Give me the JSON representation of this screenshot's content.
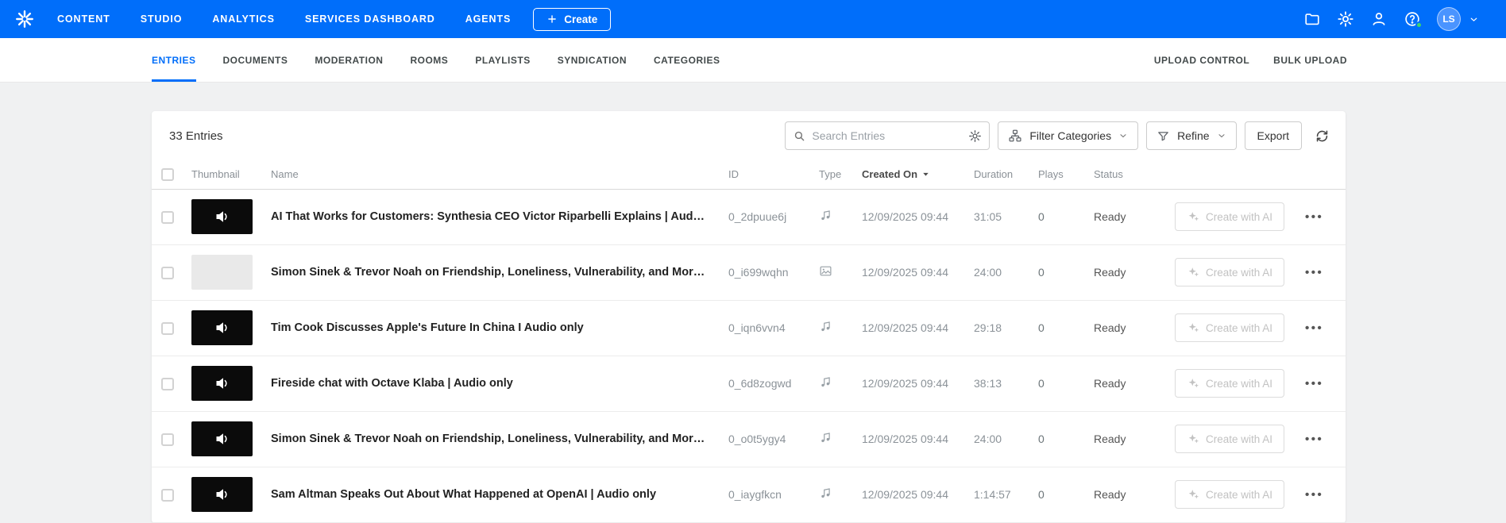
{
  "colors": {
    "accent": "#006EFA",
    "topbar": "#006EFA",
    "online_dot": "#3ED46B"
  },
  "topbar": {
    "nav": [
      {
        "label": "CONTENT",
        "active": true
      },
      {
        "label": "STUDIO",
        "active": false
      },
      {
        "label": "ANALYTICS",
        "active": false
      },
      {
        "label": "SERVICES DASHBOARD",
        "active": false
      },
      {
        "label": "AGENTS",
        "active": false
      }
    ],
    "create_label": "Create",
    "avatar_initials": "LS"
  },
  "tabs": {
    "items": [
      {
        "label": "ENTRIES",
        "active": true
      },
      {
        "label": "DOCUMENTS",
        "active": false
      },
      {
        "label": "MODERATION",
        "active": false
      },
      {
        "label": "ROOMS",
        "active": false
      },
      {
        "label": "PLAYLISTS",
        "active": false
      },
      {
        "label": "SYNDICATION",
        "active": false
      },
      {
        "label": "CATEGORIES",
        "active": false
      }
    ],
    "right_items": [
      {
        "label": "UPLOAD CONTROL"
      },
      {
        "label": "BULK UPLOAD"
      }
    ]
  },
  "toolbar": {
    "count": "33 Entries",
    "search_placeholder": "Search Entries",
    "filter_label": "Filter Categories",
    "refine_label": "Refine",
    "export_label": "Export"
  },
  "table": {
    "headers": {
      "thumbnail": "Thumbnail",
      "name": "Name",
      "id": "ID",
      "type": "Type",
      "created_on": "Created On",
      "duration": "Duration",
      "plays": "Plays",
      "status": "Status"
    },
    "create_ai_label": "Create with AI",
    "rows": [
      {
        "thumb": "audio",
        "name": "AI That Works for Customers:  Synthesia CEO Victor Riparbelli Explains | Audio o...",
        "id": "0_2dpuue6j",
        "type": "audio",
        "created_on": "12/09/2025 09:44",
        "duration": "31:05",
        "plays": "0",
        "status": "Ready"
      },
      {
        "thumb": "empty",
        "name": "Simon Sinek & Trevor Noah on Friendship, Loneliness, Vulnerability, and More  |  A...",
        "id": "0_i699wqhn",
        "type": "media",
        "created_on": "12/09/2025 09:44",
        "duration": "24:00",
        "plays": "0",
        "status": "Ready"
      },
      {
        "thumb": "audio",
        "name": "Tim Cook Discusses Apple's Future In China I Audio only",
        "id": "0_iqn6vvn4",
        "type": "audio",
        "created_on": "12/09/2025 09:44",
        "duration": "29:18",
        "plays": "0",
        "status": "Ready"
      },
      {
        "thumb": "audio",
        "name": "Fireside chat with Octave Klaba | Audio only",
        "id": "0_6d8zogwd",
        "type": "audio",
        "created_on": "12/09/2025 09:44",
        "duration": "38:13",
        "plays": "0",
        "status": "Ready"
      },
      {
        "thumb": "audio",
        "name": "Simon Sinek & Trevor Noah on Friendship, Loneliness, Vulnerability, and More  |  A...",
        "id": "0_o0t5ygy4",
        "type": "audio",
        "created_on": "12/09/2025 09:44",
        "duration": "24:00",
        "plays": "0",
        "status": "Ready"
      },
      {
        "thumb": "audio",
        "name": "Sam Altman Speaks Out About What Happened at OpenAI  |  Audio only",
        "id": "0_iaygfkcn",
        "type": "audio",
        "created_on": "12/09/2025 09:44",
        "duration": "1:14:57",
        "plays": "0",
        "status": "Ready"
      }
    ]
  }
}
